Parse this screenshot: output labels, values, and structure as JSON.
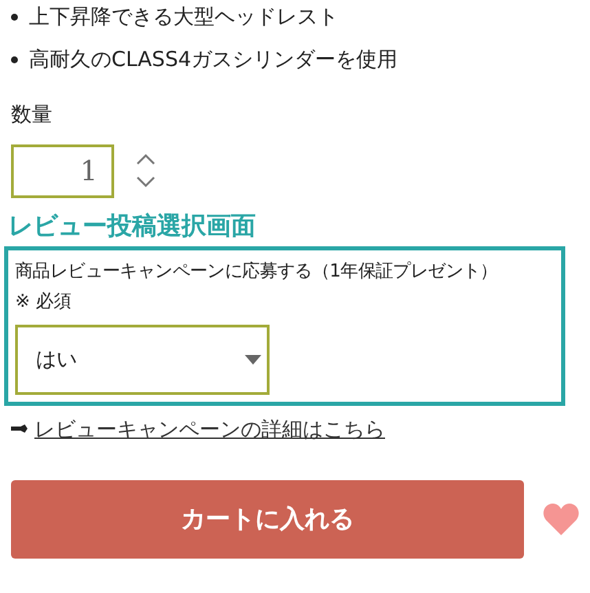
{
  "features": [
    "上下昇降できる大型ヘッドレスト",
    "高耐久のCLASS4ガスシリンダーを使用"
  ],
  "quantity": {
    "label": "数量",
    "value": "1"
  },
  "review": {
    "heading": "レビュー投稿選択画面",
    "question": "商品レビューキャンペーンに応募する（1年保証プレゼント）",
    "required": "※ 必須",
    "select_value": "はい"
  },
  "details_link": "レビューキャンペーンの詳細はこちら",
  "cart_button": "カートに入れる"
}
